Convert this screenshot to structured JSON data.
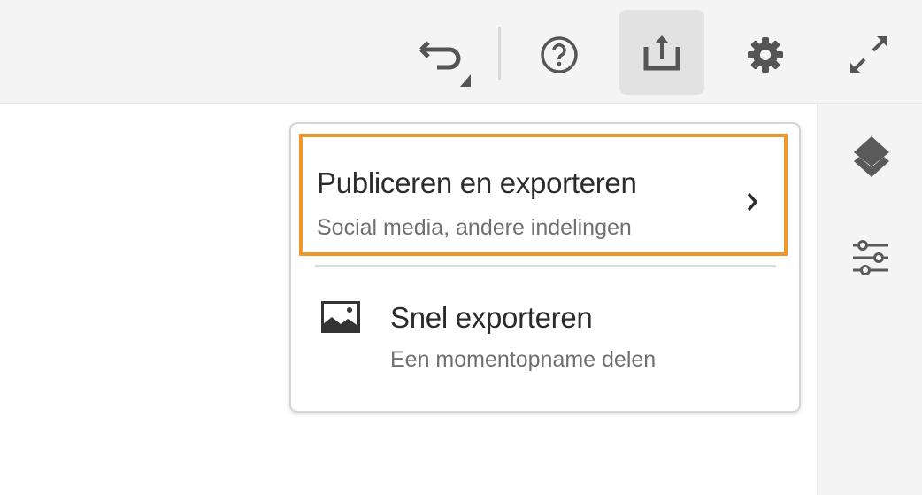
{
  "toolbar": {
    "icons": [
      "undo-icon",
      "help-icon",
      "share-icon",
      "gear-icon",
      "expand-icon"
    ]
  },
  "side_panel": {
    "icons": [
      "layers-icon",
      "sliders-icon"
    ]
  },
  "share_menu": {
    "items": [
      {
        "title": "Publiceren en exporteren",
        "subtitle": "Social media, andere indelingen",
        "highlight_color": "#f0962a"
      },
      {
        "title": "Snel exporteren",
        "subtitle": "Een momentopname delen"
      }
    ]
  }
}
